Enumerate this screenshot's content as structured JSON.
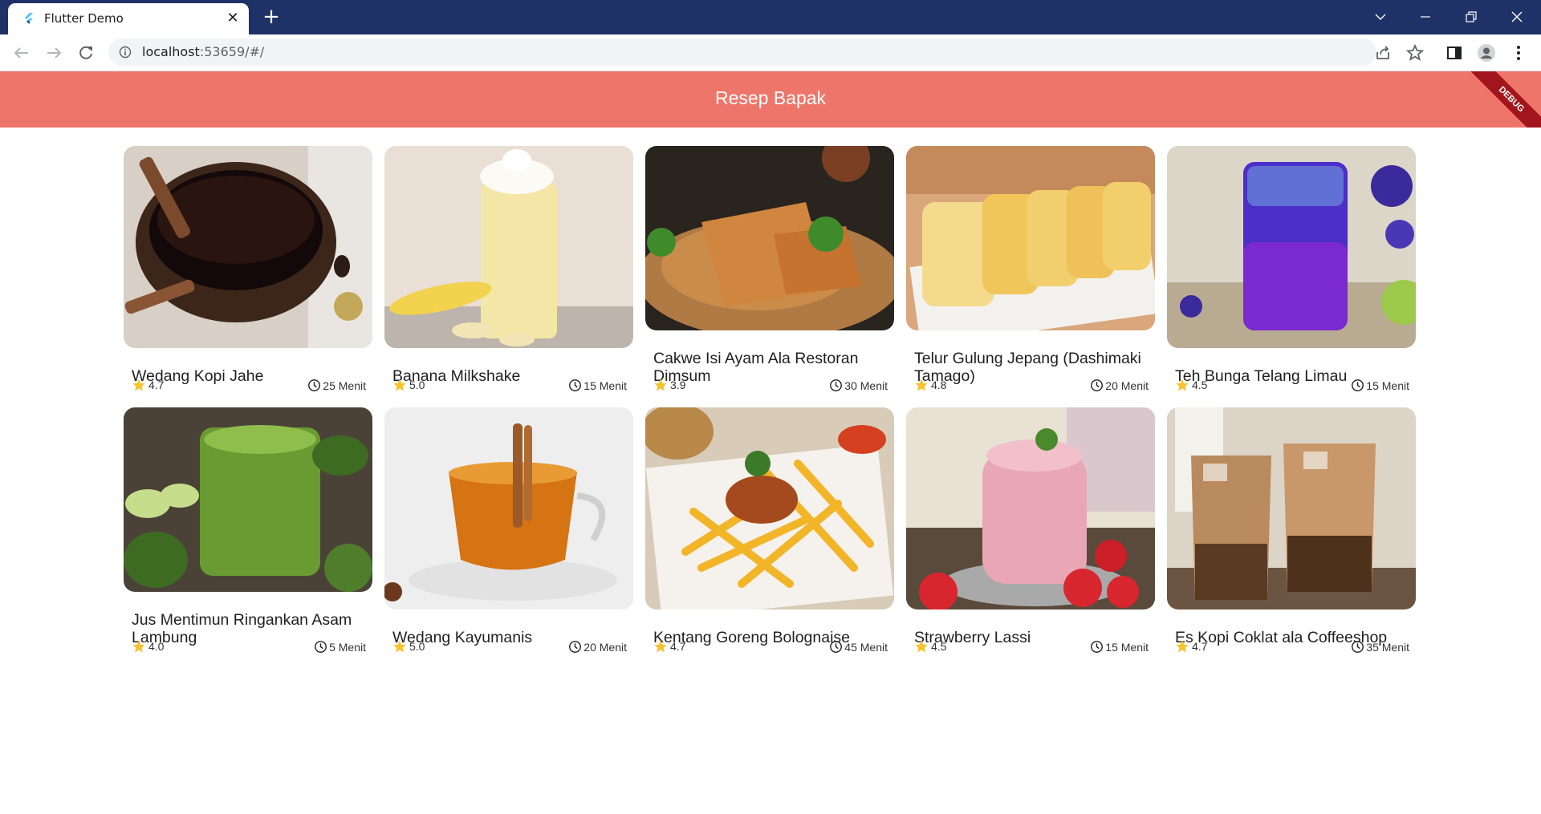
{
  "browser": {
    "tab_title": "Flutter Demo",
    "url_host": "localhost",
    "url_rest": ":53659/#/",
    "icons": [
      "flutter-logo-icon",
      "close-icon",
      "plus-icon",
      "chevron-down-icon",
      "minimize-icon",
      "restore-icon",
      "close-window-icon",
      "back-arrow-icon",
      "forward-arrow-icon",
      "reload-icon",
      "info-icon",
      "share-icon",
      "star-outline-icon",
      "side-panel-icon",
      "profile-icon",
      "more-vert-icon"
    ]
  },
  "app": {
    "title": "Resep Bapak",
    "debug_banner": "DEBUG",
    "accent": "#ee7569"
  },
  "recipes": [
    {
      "name": "Wedang Kopi Jahe",
      "rating": "4.7",
      "time": "25 Menit"
    },
    {
      "name": "Banana Milkshake",
      "rating": "5.0",
      "time": "15 Menit"
    },
    {
      "name": " Cakwe Isi Ayam Ala Restoran Dimsum",
      "rating": "3.9",
      "time": "30 Menit"
    },
    {
      "name": " Telur Gulung Jepang (Dashimaki Tamago)",
      "rating": "4.8",
      "time": "20 Menit"
    },
    {
      "name": "Teh Bunga Telang Limau",
      "rating": "4.5",
      "time": "15 Menit"
    },
    {
      "name": "Jus Mentimun Ringankan Asam Lambung",
      "rating": "4.0",
      "time": "5 Menit"
    },
    {
      "name": "Wedang Kayumanis",
      "rating": "5.0",
      "time": "20 Menit"
    },
    {
      "name": "Kentang Goreng Bolognaise",
      "rating": "4.7",
      "time": "45 Menit"
    },
    {
      "name": "Strawberry Lassi",
      "rating": "4.5",
      "time": "15 Menit"
    },
    {
      "name": "Es Kopi Coklat ala Coffeeshop",
      "rating": "4.7",
      "time": "35 Menit"
    }
  ]
}
